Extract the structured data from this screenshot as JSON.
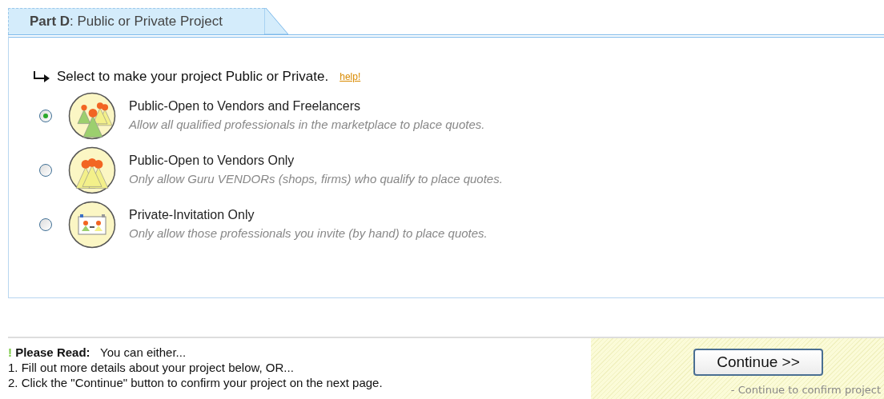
{
  "tab": {
    "part": "Part D",
    "title": ": Public or Private Project"
  },
  "prompt": {
    "text": "Select to make your project Public or Private.",
    "help": "help!"
  },
  "options": [
    {
      "kind": "everyone",
      "title": "Public-Open to Vendors and Freelancers",
      "description": "Allow all qualified professionals in the marketplace to place quotes.",
      "selected": true
    },
    {
      "kind": "vendors",
      "title": "Public-Open to Vendors Only",
      "description": "Only allow Guru VENDORs (shops, firms) who qualify to place quotes.",
      "selected": false
    },
    {
      "kind": "invite",
      "title": "Private-Invitation Only",
      "description": "Only allow those professionals you invite (by hand) to place quotes.",
      "selected": false
    }
  ],
  "notice": {
    "mark": "!",
    "label": "Please Read:",
    "intro": "You can either...",
    "steps": [
      "1. Fill out more details about your project below, OR...",
      "2. Click the \"Continue\" button to confirm your project on the next page."
    ]
  },
  "continue": {
    "button": "Continue >>",
    "caption": "- Continue to confirm project"
  }
}
